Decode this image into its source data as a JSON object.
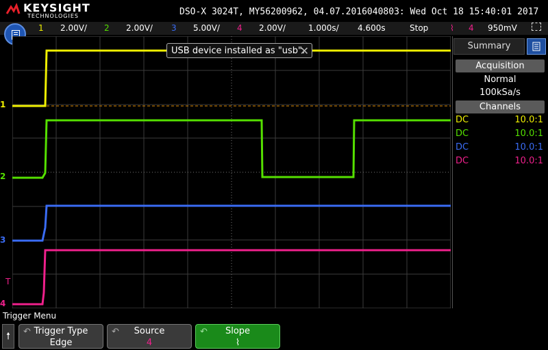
{
  "header": {
    "brand_name": "KEYSIGHT",
    "brand_sub": "TECHNOLOGIES",
    "instrument_info": "DSO-X 3024T, MY56200962, 04.07.2016040803: Wed Oct 18 15:40:01 2017"
  },
  "status_bar": {
    "ch1_num": "1",
    "ch1_scale": "2.00V/",
    "ch2_num": "2",
    "ch2_scale": "2.00V/",
    "ch3_num": "3",
    "ch3_scale": "5.00V/",
    "ch4_num": "4",
    "ch4_scale": "2.00V/",
    "timebase": "1.000s/",
    "delay": "4.600s",
    "run_state": "Stop",
    "trigger_slope_glyph": "⌇",
    "trigger_source": "4",
    "trigger_level": "950mV"
  },
  "toast": {
    "message": "USB device installed as \"usb\".",
    "close": "✕"
  },
  "side_panel": {
    "tab_label": "Summary",
    "acquisition_header": "Acquisition",
    "acq_mode": "Normal",
    "sample_rate": "100kSa/s",
    "channels_header": "Channels",
    "channels": [
      {
        "coupling": "DC",
        "probe": "10.0:1",
        "color": "#f0f000"
      },
      {
        "coupling": "DC",
        "probe": "10.0:1",
        "color": "#55e000"
      },
      {
        "coupling": "DC",
        "probe": "10.0:1",
        "color": "#3a6cf5"
      },
      {
        "coupling": "DC",
        "probe": "10.0:1",
        "color": "#f0208c"
      }
    ]
  },
  "ground_markers": {
    "ch1": "1",
    "ch2": "2",
    "ch3": "3",
    "ch4": "4",
    "trigger": "T"
  },
  "menu": {
    "title": "Trigger Menu",
    "up_glyph": "🠕",
    "keys": [
      {
        "label": "Trigger Type",
        "value": "Edge"
      },
      {
        "label": "Source",
        "value": "4"
      },
      {
        "label": "Slope",
        "value": "⌇"
      }
    ]
  },
  "colors": {
    "ch1": "#f0f000",
    "ch2": "#55e000",
    "ch3": "#3a6cf5",
    "ch4": "#f0208c",
    "trigger_level_line": "#e08a00",
    "active_key": "#1a8a1a"
  }
}
